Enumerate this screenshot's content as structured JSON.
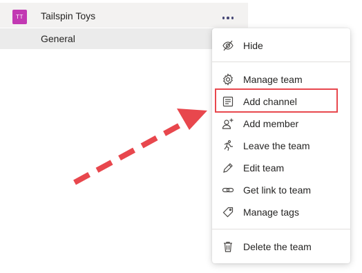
{
  "team": {
    "initials": "TT",
    "name": "Tailspin Toys",
    "avatar_color": "#c239b3"
  },
  "channel": {
    "name": "General"
  },
  "menu": {
    "items": [
      {
        "label": "Hide",
        "icon": "hide-icon"
      },
      {
        "label": "Manage team",
        "icon": "gear-icon"
      },
      {
        "label": "Add channel",
        "icon": "add-channel-icon"
      },
      {
        "label": "Add member",
        "icon": "add-member-icon"
      },
      {
        "label": "Leave the team",
        "icon": "leave-team-icon"
      },
      {
        "label": "Edit team",
        "icon": "pencil-icon"
      },
      {
        "label": "Get link to team",
        "icon": "link-icon"
      },
      {
        "label": "Manage tags",
        "icon": "tag-icon"
      },
      {
        "label": "Delete the team",
        "icon": "trash-icon"
      }
    ]
  },
  "annotation": {
    "highlight_color": "#e8474d",
    "highlighted_item": "Add channel"
  }
}
